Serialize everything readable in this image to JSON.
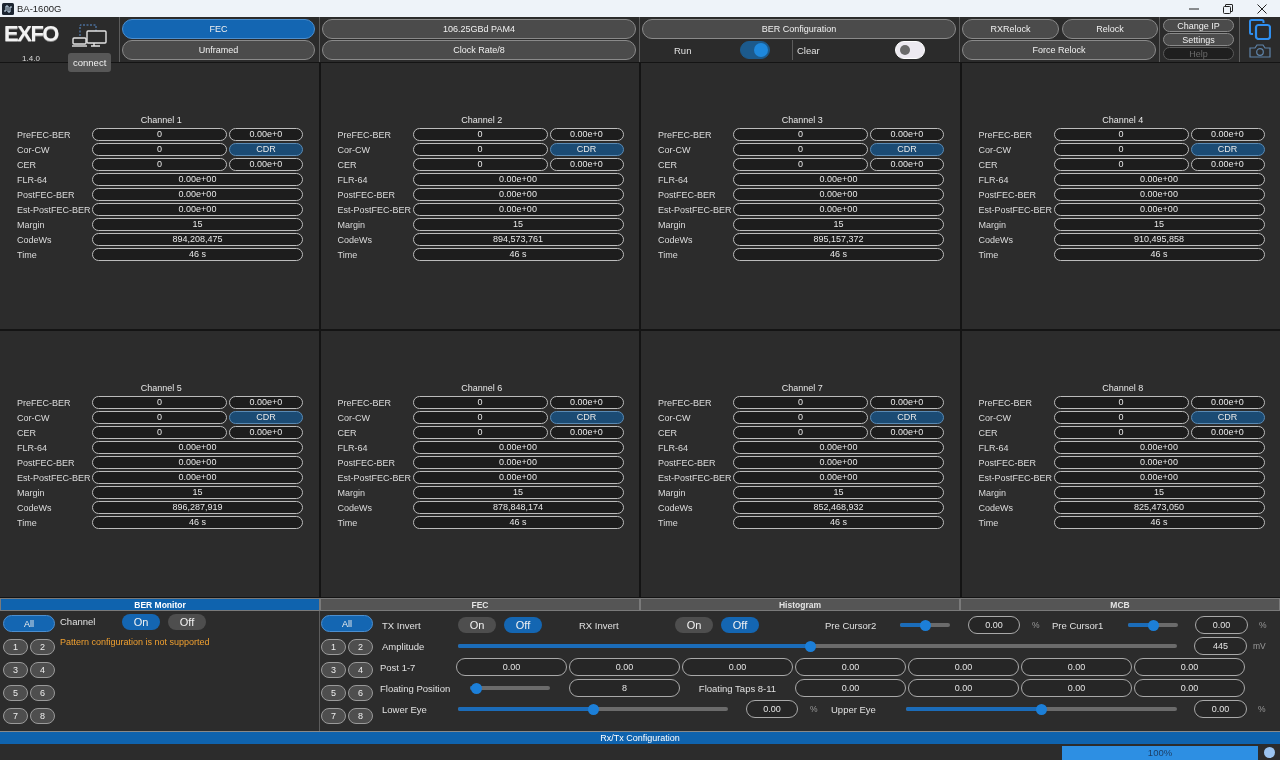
{
  "window": {
    "title": "BA-1600G"
  },
  "toolbar": {
    "logo": "EXFO",
    "version": "1.4.0",
    "tooltip": "connect",
    "mode_buttons": [
      {
        "label": "FEC",
        "selected": true
      },
      {
        "label": "Unframed",
        "selected": false
      }
    ],
    "rate_buttons": [
      {
        "label": "106.25GBd PAM4"
      },
      {
        "label": "Clock Rate/8"
      }
    ],
    "ber_configuration": {
      "label": "BER Configuration",
      "switches": [
        {
          "label": "Run",
          "on": true
        },
        {
          "label": "Clear",
          "on": false
        }
      ]
    },
    "relock_buttons": [
      {
        "label": "RXRelock"
      },
      {
        "label": "Relock"
      },
      {
        "label": "Force Relock"
      }
    ],
    "system_buttons": [
      {
        "label": "Change IP",
        "disabled": false
      },
      {
        "label": "Settings",
        "disabled": false
      },
      {
        "label": "Help",
        "disabled": true
      }
    ]
  },
  "channels": [
    {
      "title": "Channel 1",
      "rows": [
        {
          "label": "PreFEC-BER",
          "values": [
            "0",
            "0.00e+0"
          ]
        },
        {
          "label": "Cor-CW",
          "values": [
            "0"
          ],
          "status": {
            "text": "CDR",
            "on": true
          }
        },
        {
          "label": "CER",
          "values": [
            "0",
            "0.00e+0"
          ]
        },
        {
          "label": "FLR-64",
          "values": [
            "0.00e+00"
          ]
        },
        {
          "label": "PostFEC-BER",
          "values": [
            "0.00e+00"
          ]
        },
        {
          "label": "Est-PostFEC-BER",
          "values": [
            "0.00e+00"
          ]
        },
        {
          "label": "Margin",
          "values": [
            "15"
          ]
        },
        {
          "label": "CodeWs",
          "values": [
            "894,208,475"
          ]
        },
        {
          "label": "Time",
          "values": [
            "46 s"
          ]
        }
      ]
    },
    {
      "title": "Channel 2",
      "rows": [
        {
          "label": "PreFEC-BER",
          "values": [
            "0",
            "0.00e+0"
          ]
        },
        {
          "label": "Cor-CW",
          "values": [
            "0"
          ],
          "status": {
            "text": "CDR",
            "on": true
          }
        },
        {
          "label": "CER",
          "values": [
            "0",
            "0.00e+0"
          ]
        },
        {
          "label": "FLR-64",
          "values": [
            "0.00e+00"
          ]
        },
        {
          "label": "PostFEC-BER",
          "values": [
            "0.00e+00"
          ]
        },
        {
          "label": "Est-PostFEC-BER",
          "values": [
            "0.00e+00"
          ]
        },
        {
          "label": "Margin",
          "values": [
            "15"
          ]
        },
        {
          "label": "CodeWs",
          "values": [
            "894,573,761"
          ]
        },
        {
          "label": "Time",
          "values": [
            "46 s"
          ]
        }
      ]
    },
    {
      "title": "Channel 3",
      "rows": [
        {
          "label": "PreFEC-BER",
          "values": [
            "0",
            "0.00e+0"
          ]
        },
        {
          "label": "Cor-CW",
          "values": [
            "0"
          ],
          "status": {
            "text": "CDR",
            "on": true
          }
        },
        {
          "label": "CER",
          "values": [
            "0",
            "0.00e+0"
          ]
        },
        {
          "label": "FLR-64",
          "values": [
            "0.00e+00"
          ]
        },
        {
          "label": "PostFEC-BER",
          "values": [
            "0.00e+00"
          ]
        },
        {
          "label": "Est-PostFEC-BER",
          "values": [
            "0.00e+00"
          ]
        },
        {
          "label": "Margin",
          "values": [
            "15"
          ]
        },
        {
          "label": "CodeWs",
          "values": [
            "895,157,372"
          ]
        },
        {
          "label": "Time",
          "values": [
            "46 s"
          ]
        }
      ]
    },
    {
      "title": "Channel 4",
      "rows": [
        {
          "label": "PreFEC-BER",
          "values": [
            "0",
            "0.00e+0"
          ]
        },
        {
          "label": "Cor-CW",
          "values": [
            "0"
          ],
          "status": {
            "text": "CDR",
            "on": true
          }
        },
        {
          "label": "CER",
          "values": [
            "0",
            "0.00e+0"
          ]
        },
        {
          "label": "FLR-64",
          "values": [
            "0.00e+00"
          ]
        },
        {
          "label": "PostFEC-BER",
          "values": [
            "0.00e+00"
          ]
        },
        {
          "label": "Est-PostFEC-BER",
          "values": [
            "0.00e+00"
          ]
        },
        {
          "label": "Margin",
          "values": [
            "15"
          ]
        },
        {
          "label": "CodeWs",
          "values": [
            "910,495,858"
          ]
        },
        {
          "label": "Time",
          "values": [
            "46 s"
          ]
        }
      ]
    },
    {
      "title": "Channel 5",
      "rows": [
        {
          "label": "PreFEC-BER",
          "values": [
            "0",
            "0.00e+0"
          ]
        },
        {
          "label": "Cor-CW",
          "values": [
            "0"
          ],
          "status": {
            "text": "CDR",
            "on": true
          }
        },
        {
          "label": "CER",
          "values": [
            "0",
            "0.00e+0"
          ]
        },
        {
          "label": "FLR-64",
          "values": [
            "0.00e+00"
          ]
        },
        {
          "label": "PostFEC-BER",
          "values": [
            "0.00e+00"
          ]
        },
        {
          "label": "Est-PostFEC-BER",
          "values": [
            "0.00e+00"
          ]
        },
        {
          "label": "Margin",
          "values": [
            "15"
          ]
        },
        {
          "label": "CodeWs",
          "values": [
            "896,287,919"
          ]
        },
        {
          "label": "Time",
          "values": [
            "46 s"
          ]
        }
      ]
    },
    {
      "title": "Channel 6",
      "rows": [
        {
          "label": "PreFEC-BER",
          "values": [
            "0",
            "0.00e+0"
          ]
        },
        {
          "label": "Cor-CW",
          "values": [
            "0"
          ],
          "status": {
            "text": "CDR",
            "on": true
          }
        },
        {
          "label": "CER",
          "values": [
            "0",
            "0.00e+0"
          ]
        },
        {
          "label": "FLR-64",
          "values": [
            "0.00e+00"
          ]
        },
        {
          "label": "PostFEC-BER",
          "values": [
            "0.00e+00"
          ]
        },
        {
          "label": "Est-PostFEC-BER",
          "values": [
            "0.00e+00"
          ]
        },
        {
          "label": "Margin",
          "values": [
            "15"
          ]
        },
        {
          "label": "CodeWs",
          "values": [
            "878,848,174"
          ]
        },
        {
          "label": "Time",
          "values": [
            "46 s"
          ]
        }
      ]
    },
    {
      "title": "Channel 7",
      "rows": [
        {
          "label": "PreFEC-BER",
          "values": [
            "0",
            "0.00e+0"
          ]
        },
        {
          "label": "Cor-CW",
          "values": [
            "0"
          ],
          "status": {
            "text": "CDR",
            "on": true
          }
        },
        {
          "label": "CER",
          "values": [
            "0",
            "0.00e+0"
          ]
        },
        {
          "label": "FLR-64",
          "values": [
            "0.00e+00"
          ]
        },
        {
          "label": "PostFEC-BER",
          "values": [
            "0.00e+00"
          ]
        },
        {
          "label": "Est-PostFEC-BER",
          "values": [
            "0.00e+00"
          ]
        },
        {
          "label": "Margin",
          "values": [
            "15"
          ]
        },
        {
          "label": "CodeWs",
          "values": [
            "852,468,932"
          ]
        },
        {
          "label": "Time",
          "values": [
            "46 s"
          ]
        }
      ]
    },
    {
      "title": "Channel 8",
      "rows": [
        {
          "label": "PreFEC-BER",
          "values": [
            "0",
            "0.00e+0"
          ]
        },
        {
          "label": "Cor-CW",
          "values": [
            "0"
          ],
          "status": {
            "text": "CDR",
            "on": true
          }
        },
        {
          "label": "CER",
          "values": [
            "0",
            "0.00e+0"
          ]
        },
        {
          "label": "FLR-64",
          "values": [
            "0.00e+00"
          ]
        },
        {
          "label": "PostFEC-BER",
          "values": [
            "0.00e+00"
          ]
        },
        {
          "label": "Est-PostFEC-BER",
          "values": [
            "0.00e+00"
          ]
        },
        {
          "label": "Margin",
          "values": [
            "15"
          ]
        },
        {
          "label": "CodeWs",
          "values": [
            "825,473,050"
          ]
        },
        {
          "label": "Time",
          "values": [
            "46 s"
          ]
        }
      ]
    }
  ],
  "bottom_tabs": [
    {
      "label": "BER Monitor",
      "selected": true
    },
    {
      "label": "FEC",
      "selected": false
    },
    {
      "label": "Histogram",
      "selected": false
    },
    {
      "label": "MCB",
      "selected": false
    }
  ],
  "ber_monitor": {
    "channel_buttons": [
      {
        "label": "All",
        "selected": true
      },
      {
        "label": "1",
        "selected": false
      },
      {
        "label": "2",
        "selected": false
      },
      {
        "label": "3",
        "selected": false
      },
      {
        "label": "4",
        "selected": false
      },
      {
        "label": "5",
        "selected": false
      },
      {
        "label": "6",
        "selected": false
      },
      {
        "label": "7",
        "selected": false
      },
      {
        "label": "8",
        "selected": false
      }
    ],
    "channel_label": "Channel",
    "options": [
      {
        "label": "On",
        "selected": true
      },
      {
        "label": "Off",
        "selected": false
      }
    ],
    "message": "Pattern configuration is not supported"
  },
  "rx_tx_configuration": {
    "channel_buttons": [
      {
        "label": "All",
        "selected": true
      },
      {
        "label": "1",
        "selected": false
      },
      {
        "label": "2",
        "selected": false
      },
      {
        "label": "3",
        "selected": false
      },
      {
        "label": "4",
        "selected": false
      },
      {
        "label": "5",
        "selected": false
      },
      {
        "label": "6",
        "selected": false
      },
      {
        "label": "7",
        "selected": false
      },
      {
        "label": "8",
        "selected": false
      }
    ],
    "tx_invert": {
      "label": "TX Invert",
      "options": [
        {
          "label": "On",
          "selected": false
        },
        {
          "label": "Off",
          "selected": true
        }
      ]
    },
    "rx_invert": {
      "label": "RX Invert",
      "options": [
        {
          "label": "On",
          "selected": false
        },
        {
          "label": "Off",
          "selected": true
        }
      ]
    },
    "pre_cursor2": {
      "label": "Pre Cursor2",
      "level": 0.5,
      "value": "0.00",
      "unit": "%"
    },
    "pre_cursor1": {
      "label": "Pre Cursor1",
      "level": 0.5,
      "value": "0.00",
      "unit": "%"
    },
    "amplitude": {
      "label": "Amplitude",
      "level": 0.49,
      "value": "445",
      "unit": "mV"
    },
    "post_taps": {
      "label": "Post 1-7",
      "values": [
        "0.00",
        "0.00",
        "0.00",
        "0.00",
        "0.00",
        "0.00",
        "0.00"
      ]
    },
    "floating_position": {
      "label": "Floating Position",
      "level": 0.08,
      "value": "8"
    },
    "floating_taps": {
      "label": "Floating Taps 8-11",
      "values": [
        "0.00",
        "0.00",
        "0.00",
        "0.00"
      ]
    },
    "lower_eye": {
      "label": "Lower Eye",
      "level": 0.5,
      "value": "0.00",
      "unit": "%"
    },
    "upper_eye": {
      "label": "Upper Eye",
      "level": 0.5,
      "value": "0.00",
      "unit": "%"
    }
  },
  "lower_tabs": [
    {
      "label": "Rx/Tx Configuration",
      "selected": true
    }
  ],
  "status_bar": {
    "progress": {
      "level": 1,
      "text": "100%"
    }
  }
}
